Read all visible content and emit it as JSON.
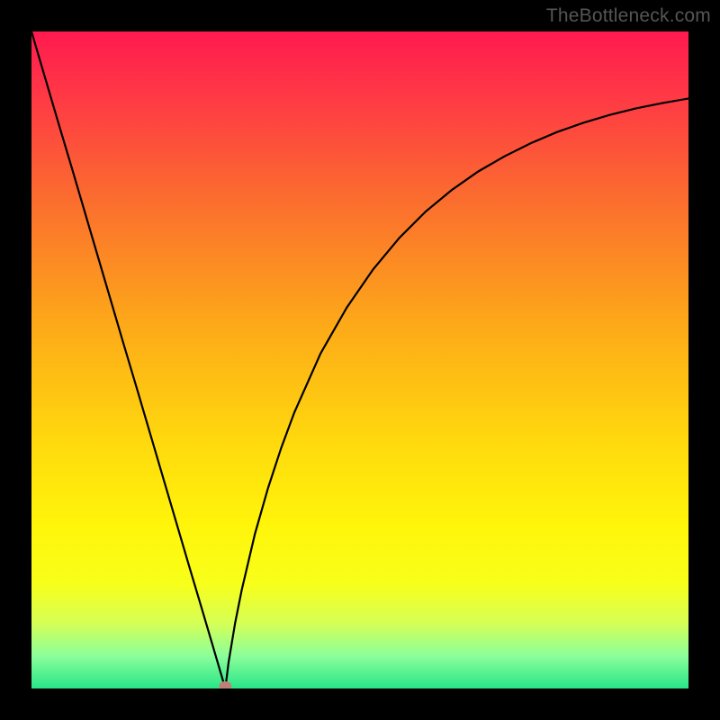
{
  "watermark": "TheBottleneck.com",
  "chart_data": {
    "type": "line",
    "title": "",
    "xlabel": "",
    "ylabel": "",
    "xlim": [
      0,
      100
    ],
    "ylim": [
      0,
      100
    ],
    "grid": false,
    "legend": false,
    "series": [
      {
        "name": "bottleneck-curve-left",
        "x": [
          0,
          2,
          4,
          6,
          8,
          10,
          12,
          14,
          16,
          18,
          20,
          22,
          24,
          26,
          27.5,
          28.5,
          29.5
        ],
        "values": [
          100,
          93.2,
          86.4,
          79.7,
          72.9,
          66.1,
          59.3,
          52.5,
          45.8,
          39.0,
          32.2,
          25.4,
          18.6,
          11.9,
          6.8,
          3.4,
          0
        ]
      },
      {
        "name": "bottleneck-curve-right",
        "x": [
          29.5,
          30,
          31,
          32,
          34,
          36,
          38,
          40,
          44,
          48,
          52,
          56,
          60,
          64,
          68,
          72,
          76,
          80,
          84,
          88,
          92,
          96,
          100
        ],
        "values": [
          0,
          4.0,
          10.0,
          15.0,
          23.5,
          30.5,
          36.6,
          42.0,
          51.0,
          58.0,
          63.8,
          68.6,
          72.6,
          75.9,
          78.7,
          81.0,
          83.0,
          84.7,
          86.1,
          87.3,
          88.3,
          89.1,
          89.8
        ]
      }
    ],
    "marker": {
      "name": "min-point",
      "x": 29.5,
      "y": 0,
      "color": "#c08078"
    },
    "background_gradient": {
      "stops": [
        {
          "pos": 0.0,
          "color": "#ff1a4f"
        },
        {
          "pos": 0.1,
          "color": "#ff3945"
        },
        {
          "pos": 0.25,
          "color": "#fb6b2f"
        },
        {
          "pos": 0.45,
          "color": "#fdaa18"
        },
        {
          "pos": 0.62,
          "color": "#ffd80e"
        },
        {
          "pos": 0.75,
          "color": "#fff50a"
        },
        {
          "pos": 0.84,
          "color": "#f8ff1a"
        },
        {
          "pos": 0.9,
          "color": "#d6ff55"
        },
        {
          "pos": 0.95,
          "color": "#8cff9a"
        },
        {
          "pos": 1.0,
          "color": "#28e588"
        }
      ]
    }
  }
}
